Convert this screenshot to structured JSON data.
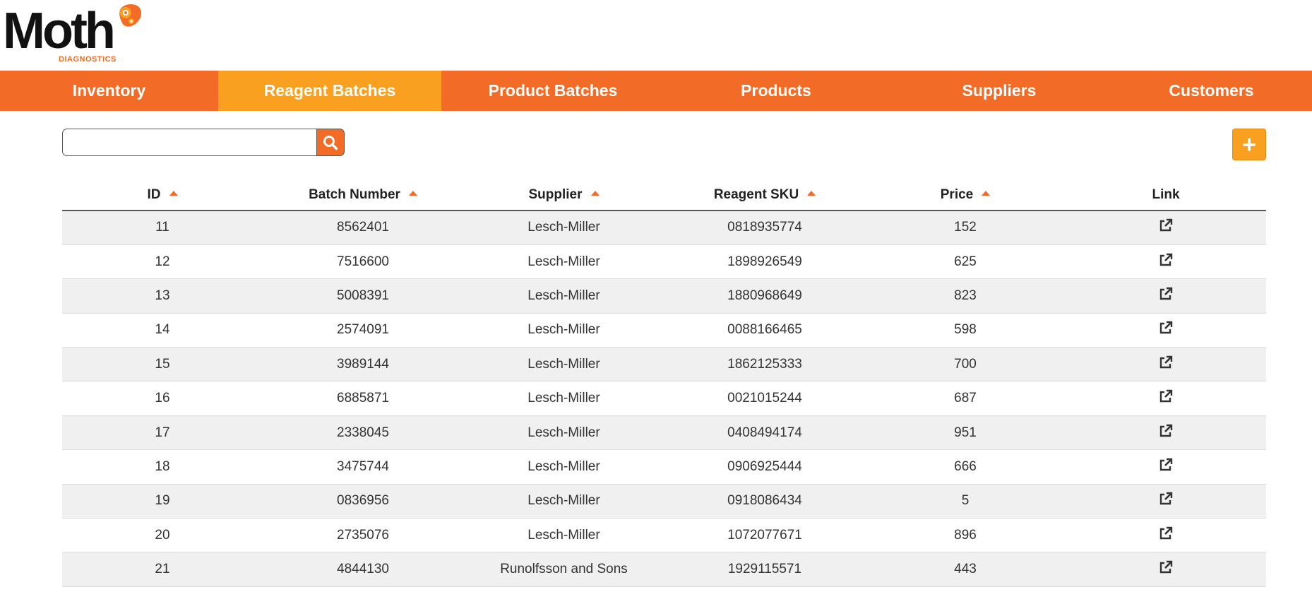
{
  "brand": {
    "name": "Moth",
    "subtitle": "DIAGNOSTICS",
    "accent_color": "#f26b27",
    "highlight_color": "#f9a021"
  },
  "nav": {
    "items": [
      {
        "label": "Inventory",
        "active": false
      },
      {
        "label": "Reagent Batches",
        "active": true
      },
      {
        "label": "Product Batches",
        "active": false
      },
      {
        "label": "Products",
        "active": false
      },
      {
        "label": "Suppliers",
        "active": false
      },
      {
        "label": "Customers",
        "active": false
      }
    ]
  },
  "search": {
    "value": "",
    "placeholder": "",
    "button_icon": "search-icon"
  },
  "add_button": {
    "label": "+"
  },
  "table": {
    "columns": [
      {
        "label": "ID",
        "sortable": true
      },
      {
        "label": "Batch Number",
        "sortable": true
      },
      {
        "label": "Supplier",
        "sortable": true
      },
      {
        "label": "Reagent SKU",
        "sortable": true
      },
      {
        "label": "Price",
        "sortable": true
      },
      {
        "label": "Link",
        "sortable": false
      }
    ],
    "rows": [
      {
        "id": "11",
        "batch": "8562401",
        "supplier": "Lesch-Miller",
        "sku": "0818935774",
        "price": "152"
      },
      {
        "id": "12",
        "batch": "7516600",
        "supplier": "Lesch-Miller",
        "sku": "1898926549",
        "price": "625"
      },
      {
        "id": "13",
        "batch": "5008391",
        "supplier": "Lesch-Miller",
        "sku": "1880968649",
        "price": "823"
      },
      {
        "id": "14",
        "batch": "2574091",
        "supplier": "Lesch-Miller",
        "sku": "0088166465",
        "price": "598"
      },
      {
        "id": "15",
        "batch": "3989144",
        "supplier": "Lesch-Miller",
        "sku": "1862125333",
        "price": "700"
      },
      {
        "id": "16",
        "batch": "6885871",
        "supplier": "Lesch-Miller",
        "sku": "0021015244",
        "price": "687"
      },
      {
        "id": "17",
        "batch": "2338045",
        "supplier": "Lesch-Miller",
        "sku": "0408494174",
        "price": "951"
      },
      {
        "id": "18",
        "batch": "3475744",
        "supplier": "Lesch-Miller",
        "sku": "0906925444",
        "price": "666"
      },
      {
        "id": "19",
        "batch": "0836956",
        "supplier": "Lesch-Miller",
        "sku": "0918086434",
        "price": "5"
      },
      {
        "id": "20",
        "batch": "2735076",
        "supplier": "Lesch-Miller",
        "sku": "1072077671",
        "price": "896"
      },
      {
        "id": "21",
        "batch": "4844130",
        "supplier": "Runolfsson and Sons",
        "sku": "1929115571",
        "price": "443"
      }
    ]
  }
}
